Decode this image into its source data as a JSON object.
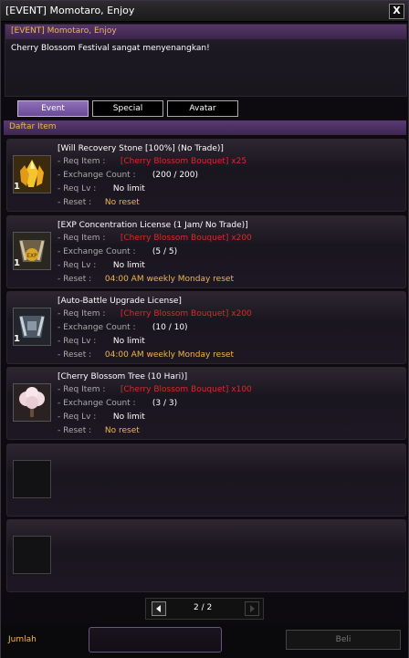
{
  "window": {
    "title": "[EVENT] Momotaro, Enjoy",
    "close_label": "X"
  },
  "npc": {
    "name": "[EVENT] Momotaro, Enjoy",
    "message": "Cherry Blossom Festival sangat menyenangkan!"
  },
  "tabs": [
    {
      "label": "Event",
      "active": true
    },
    {
      "label": "Special",
      "active": false
    },
    {
      "label": "Avatar",
      "active": false
    }
  ],
  "section_title": "Daftar Item",
  "labels": {
    "req_item": "- Req Item :",
    "exchange_count": "- Exchange Count :",
    "req_lv": "- Req Lv :",
    "reset": "- Reset :"
  },
  "items": [
    {
      "name": "[Will Recovery Stone [100%] (No Trade)]",
      "req_item": "[Cherry Blossom Bouquet] x25",
      "exchange_count": "(200 / 200)",
      "req_lv": "No limit",
      "reset": "No reset",
      "quantity": "1",
      "icon": "gold-crystal-icon"
    },
    {
      "name": "[EXP Concentration License (1 Jam/ No Trade)]",
      "req_item": "[Cherry Blossom Bouquet] x200",
      "exchange_count": "(5 / 5)",
      "req_lv": "No limit",
      "reset": "04:00 AM weekly Monday reset",
      "quantity": "1",
      "icon": "exp-scroll-icon"
    },
    {
      "name": "[Auto-Battle Upgrade License]",
      "req_item": "[Cherry Blossom Bouquet] x200",
      "exchange_count": "(10 / 10)",
      "req_lv": "No limit",
      "reset": "04:00 AM weekly Monday reset",
      "quantity": "1",
      "icon": "battle-scroll-icon"
    },
    {
      "name": "[Cherry Blossom Tree (10 Hari)]",
      "req_item": "[Cherry Blossom Bouquet] x100",
      "exchange_count": "(3 / 3)",
      "req_lv": "No limit",
      "reset": "No reset",
      "quantity": "",
      "icon": "cherry-tree-icon"
    }
  ],
  "pagination": {
    "text": "2 / 2"
  },
  "bottom": {
    "quantity_label": "Jumlah",
    "buy_label": "Beli"
  }
}
